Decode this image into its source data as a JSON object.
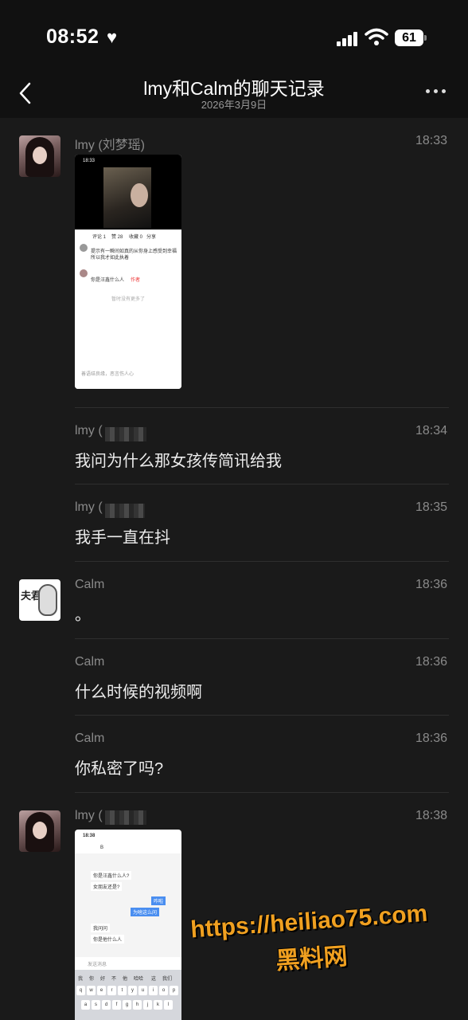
{
  "status": {
    "time": "08:52",
    "battery": "61"
  },
  "header": {
    "title": "lmy和Calm的聊天记录",
    "date": "2026年3月9日"
  },
  "messages": [
    {
      "sender": "lmy (刘梦瑶)",
      "time": "18:33",
      "type": "image"
    },
    {
      "sender": "lmy (",
      "time": "18:34",
      "text": "我问为什么那女孩传简讯给我"
    },
    {
      "sender": "lmy (",
      "time": "18:35",
      "text": "我手一直在抖"
    },
    {
      "sender": "Calm",
      "time": "18:36",
      "text": "。"
    },
    {
      "sender": "Calm",
      "time": "18:36",
      "text": "什么时候的视频啊"
    },
    {
      "sender": "Calm",
      "time": "18:36",
      "text": "你私密了吗?"
    },
    {
      "sender": "lmy (",
      "time": "18:38",
      "type": "image"
    }
  ],
  "avatar_labels": {
    "calm": "夫君"
  },
  "shot1": {
    "time": "18:33",
    "tabs": [
      "评论 1",
      "赞 28",
      "收藏 0",
      "分享"
    ],
    "comment1": "提示有一瞬间如真的从你身上感受到幸福 所以我才如此执着",
    "comment2": "你是汪鑫什么人",
    "tag": "作者",
    "no_more": "暂时没有更多了",
    "input_placeholder": "善语结良缘，恶言伤人心"
  },
  "shot2": {
    "time": "18:38",
    "contact": "B",
    "msgs_left": [
      "你是汪鑫什么人?",
      "女朋友还是?"
    ],
    "msgs_right": [
      "咋啦",
      "为啥这么问"
    ],
    "msgs_left2": [
      "我问问",
      "你是他什么人"
    ],
    "input_placeholder": "发送消息",
    "kb_words": [
      "我",
      "你",
      "好",
      "不",
      "他",
      "哈哈",
      "这",
      "我们"
    ],
    "kb_row1": [
      "q",
      "w",
      "e",
      "r",
      "t",
      "y",
      "u",
      "i",
      "o",
      "p"
    ],
    "kb_row2": [
      "a",
      "s",
      "d",
      "f",
      "g",
      "h",
      "j",
      "k",
      "l"
    ]
  },
  "watermark": {
    "url": "https://heiliao75.com",
    "name": "黑料网"
  }
}
